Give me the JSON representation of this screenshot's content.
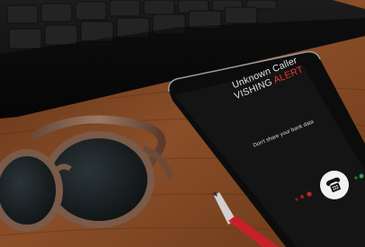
{
  "phone": {
    "caller_label": "Unknown Caller",
    "alert_word_1": "VISHING",
    "alert_word_2": "ALERT",
    "warning_text": "Don't share your bank data",
    "answer_icon": "phone-handset-icon"
  },
  "colors": {
    "desk": "#7a4523",
    "alert_red": "#e53a2e",
    "screen": "#141414",
    "pen": "#c8202a"
  }
}
